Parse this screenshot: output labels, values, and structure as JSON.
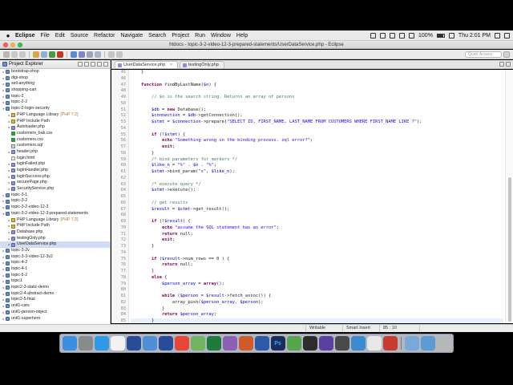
{
  "menubar": {
    "app": "Eclipse",
    "items": [
      "File",
      "Edit",
      "Source",
      "Refactor",
      "Navigate",
      "Search",
      "Project",
      "Run",
      "Window",
      "Help"
    ],
    "battery": "100%",
    "clock": "Thu 2:01 PM"
  },
  "window": {
    "title": "htdocs - topic-3-2-video-12-3-prepared-statements/UserDataService.php - Eclipse"
  },
  "toolbar": {
    "quick_access_placeholder": "Quick Access"
  },
  "explorer": {
    "title": "Project Explorer",
    "rows": [
      {
        "label": "bootstrap-shop",
        "icon": "folder-project-icon",
        "indent": 0,
        "tw": "▸",
        "sub": ""
      },
      {
        "label": "digi-shop",
        "icon": "folder-project-icon",
        "indent": 0,
        "tw": "▸",
        "sub": ""
      },
      {
        "label": "sell-anything",
        "icon": "folder-project-icon",
        "indent": 0,
        "tw": "▸",
        "sub": ""
      },
      {
        "label": "shopping-cart",
        "icon": "folder-project-icon",
        "indent": 0,
        "tw": "▸",
        "sub": ""
      },
      {
        "label": "topic-2",
        "icon": "folder-project-icon",
        "indent": 0,
        "tw": "▸",
        "sub": ""
      },
      {
        "label": "topic-2-2",
        "icon": "folder-project-icon",
        "indent": 0,
        "tw": "▸",
        "sub": ""
      },
      {
        "label": "topic-2-login-security",
        "icon": "folder-project-icon",
        "indent": 0,
        "tw": "▾",
        "sub": ""
      },
      {
        "label": "PHP Language Library",
        "icon": "library-icon",
        "indent": 1,
        "tw": "▸",
        "sub": "[PHP 7.2]"
      },
      {
        "label": "PHP Include Path",
        "icon": "library-icon",
        "indent": 1,
        "tw": "▸",
        "sub": ""
      },
      {
        "label": "Autoloader.php",
        "icon": "php-file-icon",
        "indent": 1,
        "tw": "▸",
        "sub": ""
      },
      {
        "label": "customers_bak.csv",
        "icon": "csv-file-icon",
        "indent": 1,
        "tw": "",
        "sub": ""
      },
      {
        "label": "customers.csv",
        "icon": "csv-file-icon",
        "indent": 1,
        "tw": "",
        "sub": ""
      },
      {
        "label": "customers.sql",
        "icon": "sql-file-icon",
        "indent": 1,
        "tw": "",
        "sub": ""
      },
      {
        "label": "header.php",
        "icon": "php-file-icon",
        "indent": 1,
        "tw": "▸",
        "sub": ""
      },
      {
        "label": "login.html",
        "icon": "html-file-icon",
        "indent": 1,
        "tw": "",
        "sub": ""
      },
      {
        "label": "loginFailed.php",
        "icon": "php-file-icon",
        "indent": 1,
        "tw": "▸",
        "sub": ""
      },
      {
        "label": "loginHandler.php",
        "icon": "php-file-icon",
        "indent": 1,
        "tw": "▸",
        "sub": ""
      },
      {
        "label": "loginSuccess.php",
        "icon": "php-file-icon",
        "indent": 1,
        "tw": "▸",
        "sub": ""
      },
      {
        "label": "securePage.php",
        "icon": "php-file-icon",
        "indent": 1,
        "tw": "▸",
        "sub": ""
      },
      {
        "label": "SecurityService.php",
        "icon": "php-file-icon",
        "indent": 1,
        "tw": "▸",
        "sub": ""
      },
      {
        "label": "topic-3-1",
        "icon": "folder-project-icon",
        "indent": 0,
        "tw": "▸",
        "sub": ""
      },
      {
        "label": "topic-3-2",
        "icon": "folder-project-icon",
        "indent": 0,
        "tw": "▸",
        "sub": ""
      },
      {
        "label": "topic-3-2-video-12-3",
        "icon": "folder-project-icon",
        "indent": 0,
        "tw": "▸",
        "sub": ""
      },
      {
        "label": "topic-3-2-video-12-3-prepared-statements",
        "icon": "folder-project-icon",
        "indent": 0,
        "tw": "▾",
        "sub": ""
      },
      {
        "label": "PHP Language Library",
        "icon": "library-icon",
        "indent": 1,
        "tw": "▸",
        "sub": "[PHP 7.2]"
      },
      {
        "label": "PHP Include Path",
        "icon": "library-icon",
        "indent": 1,
        "tw": "▸",
        "sub": ""
      },
      {
        "label": "Database.php",
        "icon": "php-file-icon",
        "indent": 1,
        "tw": "▸",
        "sub": ""
      },
      {
        "label": "testingOnly.php",
        "icon": "php-file-icon",
        "indent": 1,
        "tw": "▸",
        "sub": ""
      },
      {
        "label": "UserDataService.php",
        "icon": "php-file-icon",
        "indent": 1,
        "tw": "▸",
        "sub": "",
        "selected": true
      },
      {
        "label": "topic-3-2v",
        "icon": "folder-project-icon",
        "indent": 0,
        "tw": "▸",
        "sub": ""
      },
      {
        "label": "topic-3-3-video-12-3v2",
        "icon": "folder-project-icon",
        "indent": 0,
        "tw": "▸",
        "sub": ""
      },
      {
        "label": "topic-4-2",
        "icon": "folder-project-icon",
        "indent": 0,
        "tw": "▸",
        "sub": ""
      },
      {
        "label": "topic-4-1",
        "icon": "folder-project-icon",
        "indent": 0,
        "tw": "▸",
        "sub": ""
      },
      {
        "label": "topic-5-2",
        "icon": "folder-project-icon",
        "indent": 0,
        "tw": "▸",
        "sub": ""
      },
      {
        "label": "topic1",
        "icon": "folder-project-icon",
        "indent": 0,
        "tw": "▸",
        "sub": ""
      },
      {
        "label": "topic2-3-static-demo",
        "icon": "folder-project-icon",
        "indent": 0,
        "tw": "▸",
        "sub": ""
      },
      {
        "label": "topic2-4-abstract-demo",
        "icon": "folder-project-icon",
        "indent": 0,
        "tw": "▸",
        "sub": ""
      },
      {
        "label": "topic2-5-final",
        "icon": "folder-project-icon",
        "indent": 0,
        "tw": "▸",
        "sub": ""
      },
      {
        "label": "unit1-cars",
        "icon": "folder-project-icon",
        "indent": 0,
        "tw": "▸",
        "sub": ""
      },
      {
        "label": "unit1-person-object",
        "icon": "folder-project-icon",
        "indent": 0,
        "tw": "▸",
        "sub": ""
      },
      {
        "label": "unit1-superhero",
        "icon": "folder-project-icon",
        "indent": 0,
        "tw": "▸",
        "sub": ""
      }
    ]
  },
  "editor": {
    "tabs": [
      {
        "label": "UserDataService.php",
        "active": true
      },
      {
        "label": "testingOnly.php",
        "active": false
      }
    ],
    "code": [
      {
        "n": "45",
        "t": "    }"
      },
      {
        "n": "46",
        "t": ""
      },
      {
        "n": "47",
        "t": "    function findByLastName($n) {"
      },
      {
        "n": "48",
        "t": ""
      },
      {
        "n": "49",
        "t": "        // $n is the search string. Returns an array of persons"
      },
      {
        "n": "50",
        "t": ""
      },
      {
        "n": "51",
        "t": "        $db = new Database();"
      },
      {
        "n": "52",
        "t": "        $connection = $db->getConnection();"
      },
      {
        "n": "53",
        "t": "        $stmt = $connection->prepare(\"SELECT ID, FIRST_NAME, LAST_NAME FROM CUSTOMERS WHERE FIRST_NAME LIKE ?\");"
      },
      {
        "n": "54",
        "t": ""
      },
      {
        "n": "55",
        "t": "        if (!$stmt) {"
      },
      {
        "n": "56",
        "t": "            echo \"Something wrong in the binding process. sql error?\";"
      },
      {
        "n": "57",
        "t": "            exit;"
      },
      {
        "n": "58",
        "t": "        }"
      },
      {
        "n": "59",
        "t": "        /* bind parameters for markers */"
      },
      {
        "n": "60",
        "t": "        $like_n = \"%\" . $n . \"%\";"
      },
      {
        "n": "61",
        "t": "        $stmt->bind_param(\"s\", $like_n);"
      },
      {
        "n": "62",
        "t": ""
      },
      {
        "n": "63",
        "t": "        /* execute query */"
      },
      {
        "n": "64",
        "t": "        $stmt->execute();"
      },
      {
        "n": "65",
        "t": ""
      },
      {
        "n": "66",
        "t": "        // get results"
      },
      {
        "n": "67",
        "t": "        $result = $stmt->get_result();"
      },
      {
        "n": "68",
        "t": ""
      },
      {
        "n": "69",
        "t": "        if (!$result) {"
      },
      {
        "n": "70",
        "t": "            echo \"assume the SQL statement has an error\";"
      },
      {
        "n": "71",
        "t": "            return null;"
      },
      {
        "n": "72",
        "t": "            exit;"
      },
      {
        "n": "73",
        "t": "        }"
      },
      {
        "n": "74",
        "t": ""
      },
      {
        "n": "75",
        "t": "        if ($result->num_rows == 0 ) {"
      },
      {
        "n": "76",
        "t": "            return null;"
      },
      {
        "n": "77",
        "t": "        }"
      },
      {
        "n": "78",
        "t": "        else {"
      },
      {
        "n": "79",
        "t": "            $person_array = array();"
      },
      {
        "n": "80",
        "t": ""
      },
      {
        "n": "81",
        "t": "            while ($person = $result->fetch_assoc()) {"
      },
      {
        "n": "82",
        "t": "                array_push($person_array, $person);"
      },
      {
        "n": "83",
        "t": "            }"
      },
      {
        "n": "84",
        "t": "            return $person_array;"
      },
      {
        "n": "85",
        "t": "        }",
        "current": true
      }
    ]
  },
  "status": {
    "writable": "Writable",
    "insert_mode": "Smart Insert",
    "position": "85 : 10"
  },
  "colors": {
    "keyword": "#7f0055",
    "string": "#2a00ff",
    "comment": "#3f7f5f",
    "variable": "#0000c0"
  },
  "dock": {
    "apps": [
      "finder-icon",
      "launchpad-icon",
      "safari-icon",
      "calendar-icon",
      "flag-app-icon",
      "mail-icon",
      "flag-app-icon",
      "chrome-icon",
      "maps-icon",
      "excel-icon",
      "tools-icon",
      "powerpoint-icon",
      "word-icon",
      "photoshop-icon",
      "chat-icon",
      "terminal-icon",
      "imovie-icon",
      "console-icon",
      "preview-icon",
      "text-editor-icon",
      "pdf-icon",
      "finder-window-icon",
      "downloads-icon",
      "trash-icon"
    ],
    "photoshop_label": "Ps"
  }
}
